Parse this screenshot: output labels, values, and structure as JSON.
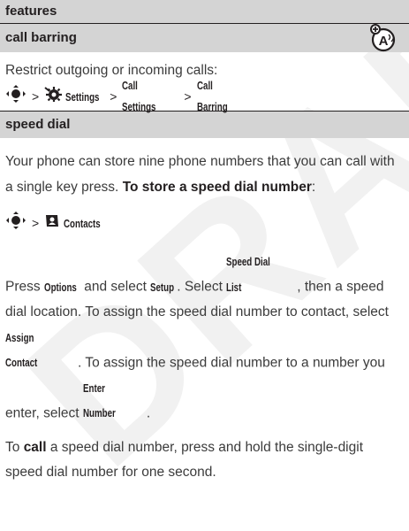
{
  "watermark": "DRAFT",
  "header": {
    "title": "features"
  },
  "call_barring": {
    "title": "call barring",
    "intro": "Restrict outgoing or incoming calls:",
    "path": {
      "settings": "Settings",
      "sep": ">",
      "call_settings": "Call Settings",
      "call_barring": "Call Barring"
    }
  },
  "speed_dial": {
    "title": "speed dial",
    "p1_a": "Your phone can store nine phone numbers that you can call with a single key press. ",
    "p1_b": "To store a speed dial number",
    "p1_c": ":",
    "path": {
      "contacts": "Contacts"
    },
    "p2": {
      "t1": "Press ",
      "options": "Options",
      "t2": " and select ",
      "setup": "Setup",
      "t3": ". Select ",
      "sdl": "Speed Dial List",
      "t4": ", then a speed dial location. To assign the speed dial number to contact, select ",
      "assign": "Assign Contact",
      "t5": ". To assign the speed dial number to a number you enter, select ",
      "enter": "Enter Number",
      "t6": "."
    },
    "p3": {
      "t1": "To ",
      "call": "call",
      "t2": " a speed dial number, press and hold the single-digit speed dial number for one second."
    }
  }
}
